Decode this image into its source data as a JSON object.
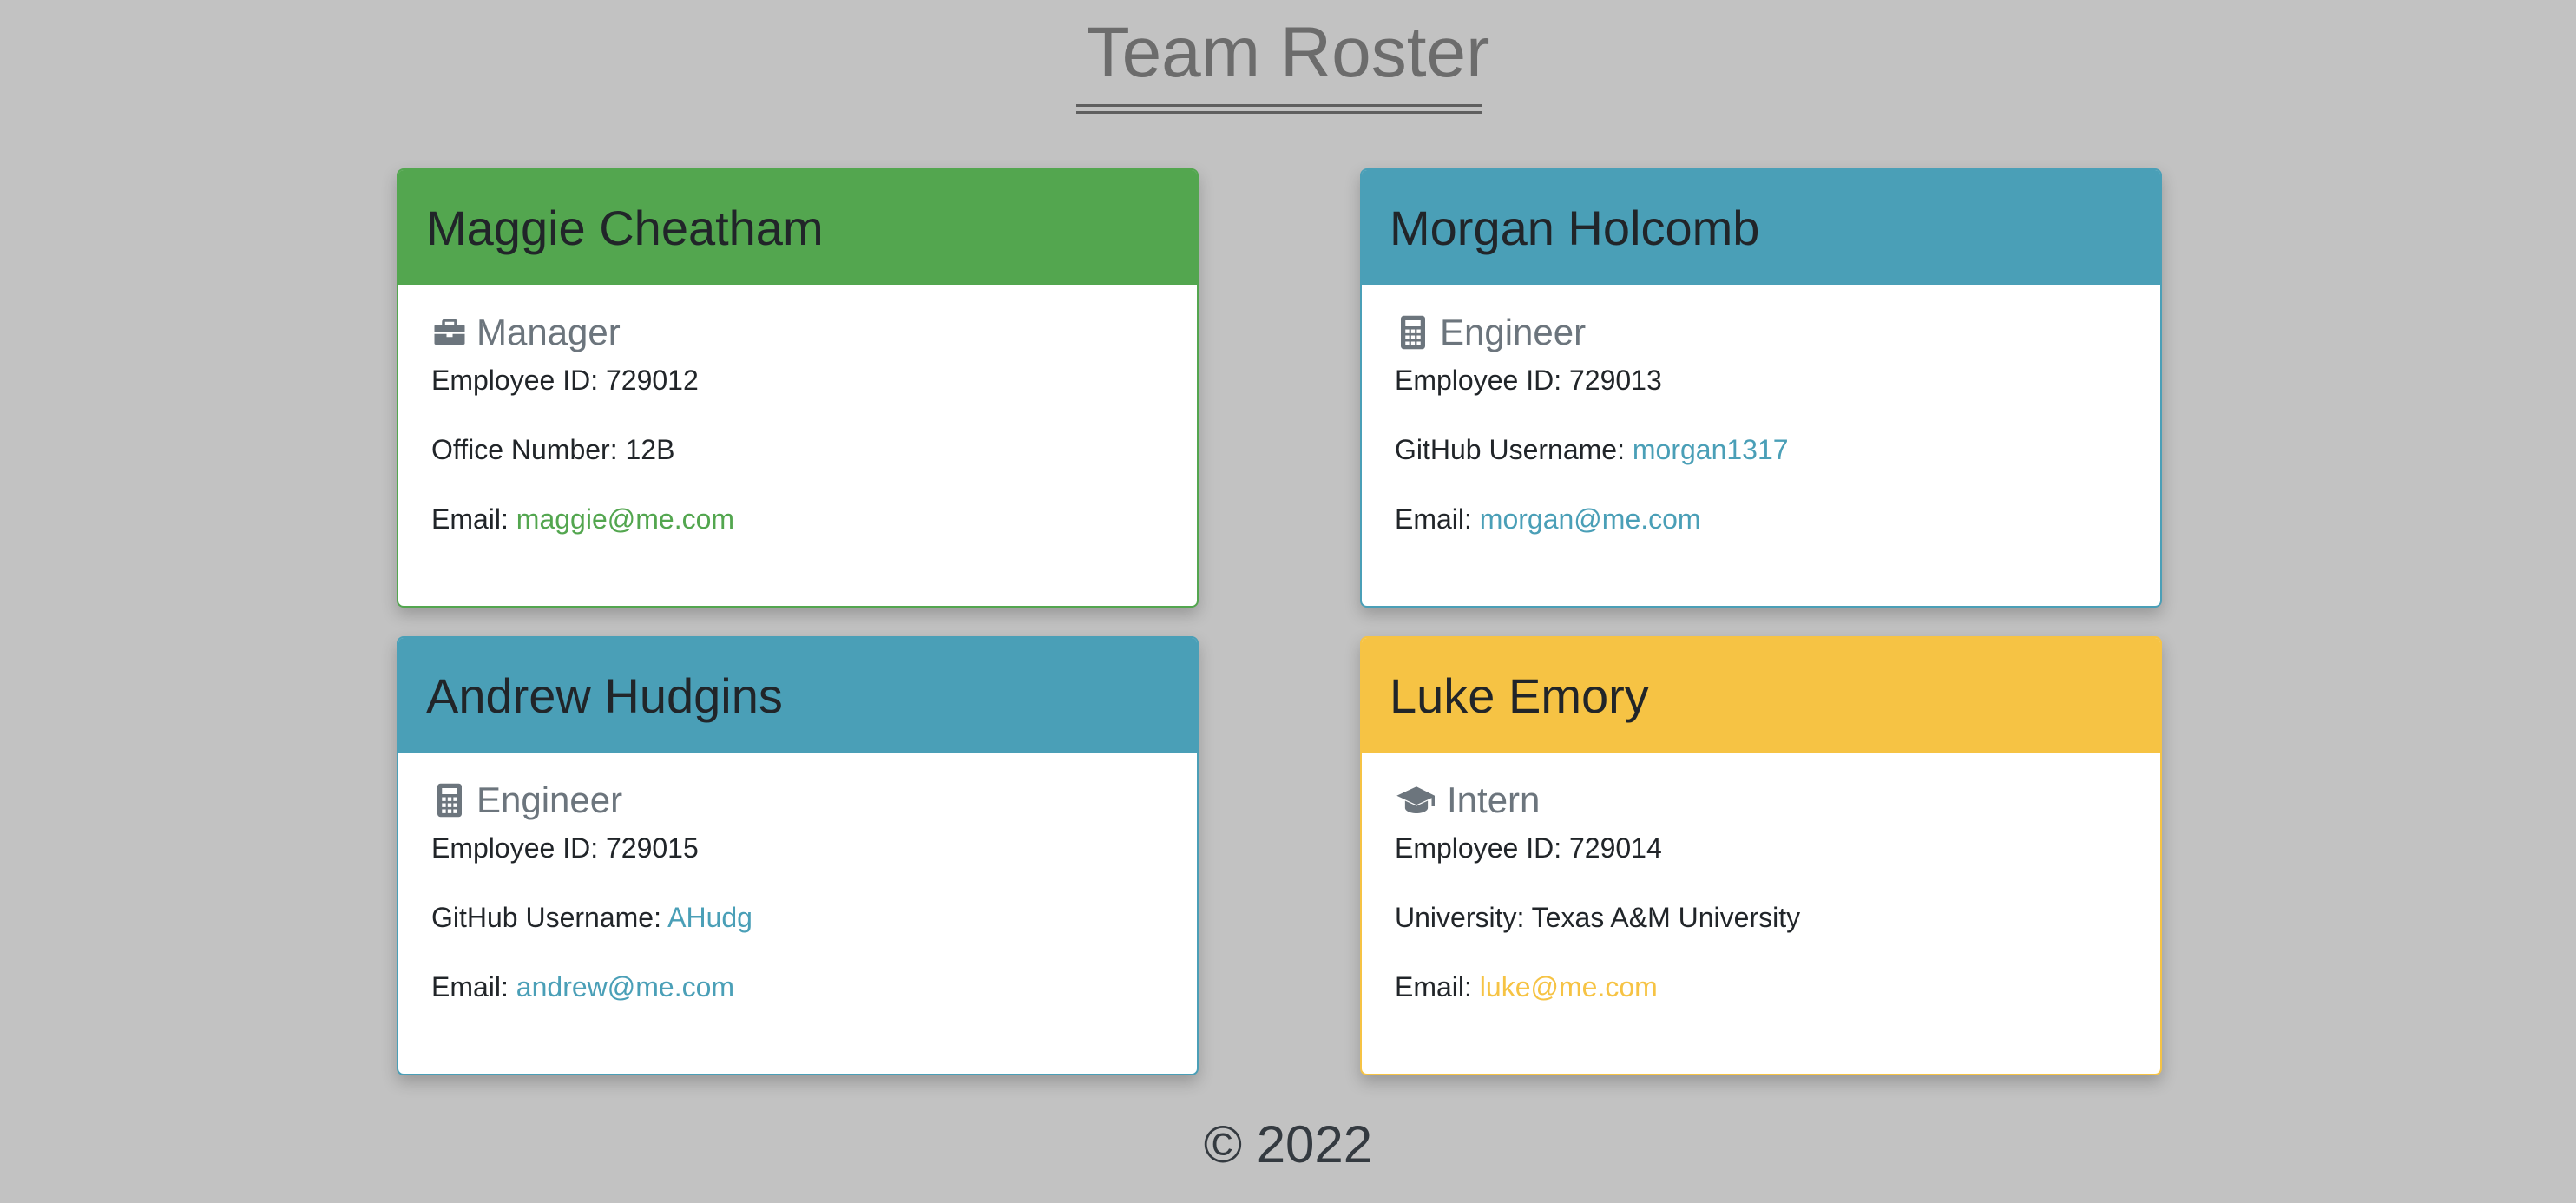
{
  "page": {
    "title": "Team Roster",
    "footer": "© 2022"
  },
  "colors": {
    "background": "#c2c2c2",
    "manager": "#53a64f",
    "engineer": "#4a9fb7",
    "intern": "#f6c344"
  },
  "cards": [
    {
      "name": "Maggie Cheatham",
      "role": "Manager",
      "role_icon": "briefcase-icon",
      "id_label": "Employee ID:",
      "id_value": "729012",
      "detail_label": "Office Number:",
      "detail_value": "12B",
      "email_label": "Email:",
      "email_value": "maggie@me.com"
    },
    {
      "name": "Morgan Holcomb",
      "role": "Engineer",
      "role_icon": "calculator-icon",
      "id_label": "Employee ID:",
      "id_value": "729013",
      "detail_label": "GitHub Username:",
      "detail_value": "morgan1317",
      "email_label": "Email:",
      "email_value": "morgan@me.com"
    },
    {
      "name": "Andrew Hudgins",
      "role": "Engineer",
      "role_icon": "calculator-icon",
      "id_label": "Employee ID:",
      "id_value": "729015",
      "detail_label": "GitHub Username:",
      "detail_value": "AHudg",
      "email_label": "Email:",
      "email_value": "andrew@me.com"
    },
    {
      "name": "Luke Emory",
      "role": "Intern",
      "role_icon": "graduation-cap-icon",
      "id_label": "Employee ID:",
      "id_value": "729014",
      "detail_label": "University:",
      "detail_value": "Texas A&M University",
      "email_label": "Email:",
      "email_value": "luke@me.com"
    }
  ]
}
